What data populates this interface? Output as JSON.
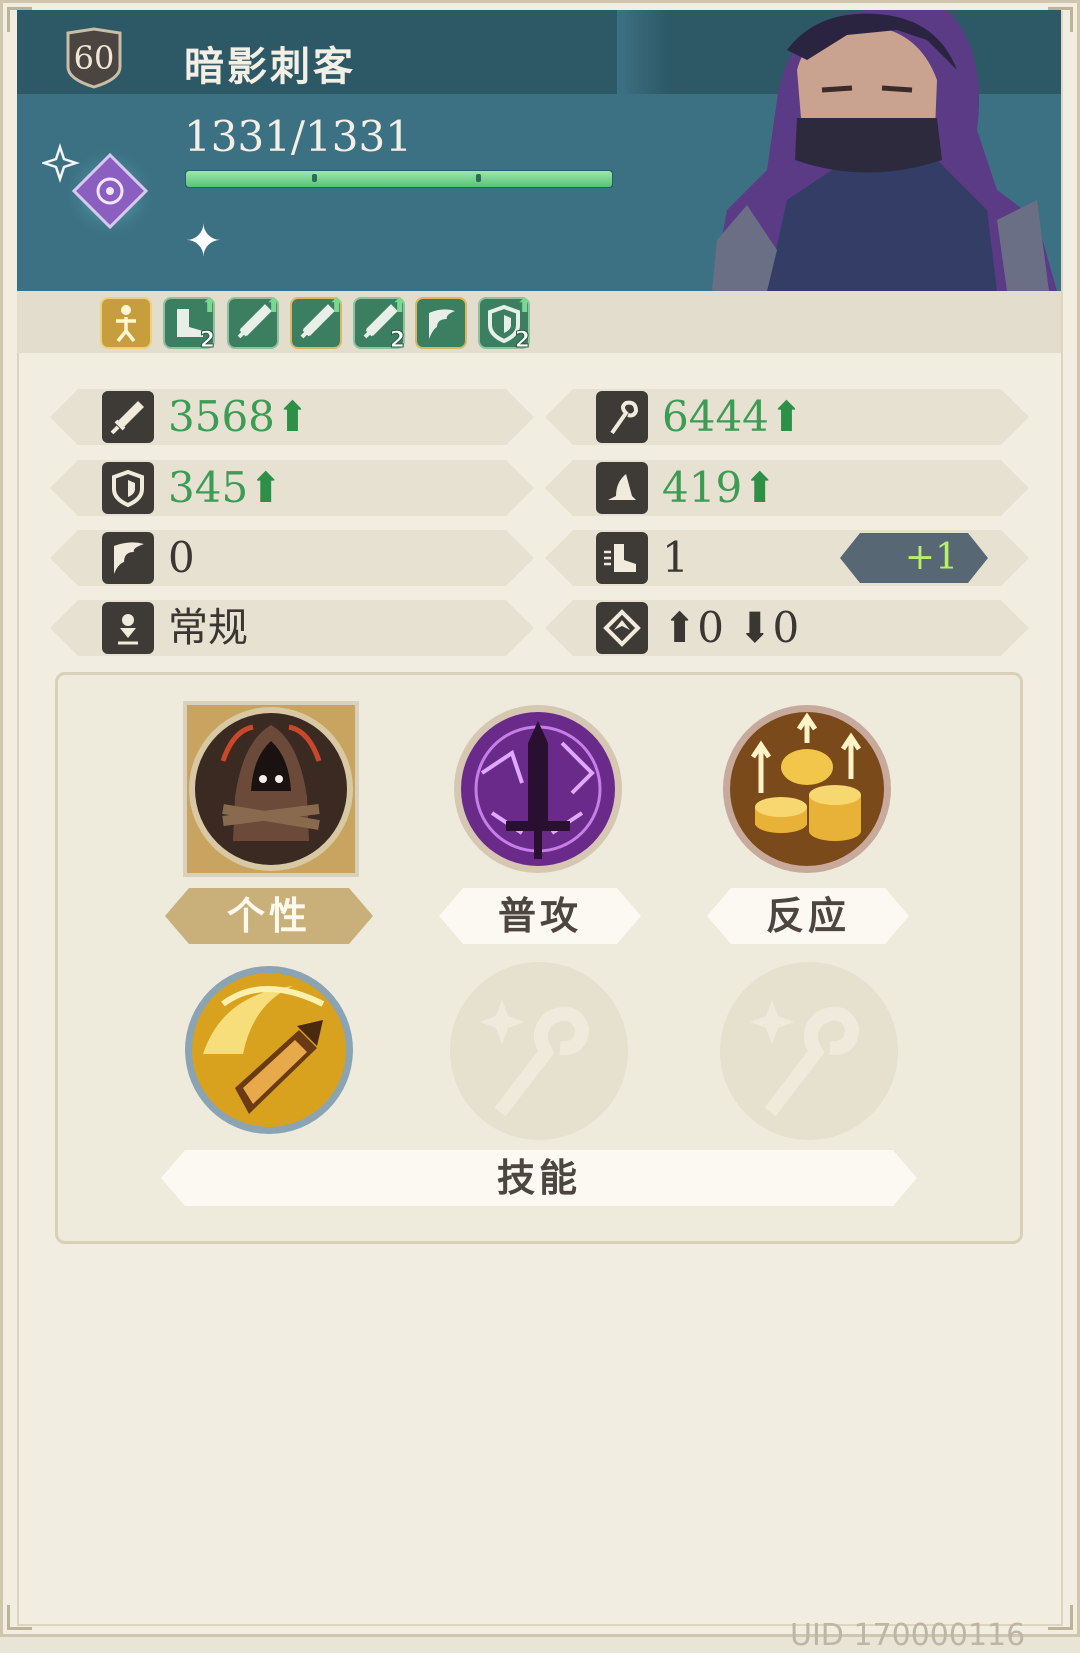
{
  "header": {
    "level": "60",
    "name": "暗影刺客",
    "hp_text": "1331/1331",
    "hp_fraction": 1.0,
    "element_icon": "arcane-eye-diamond-icon",
    "star_icon": "✦"
  },
  "buffs": [
    {
      "icon": "full-body-buff-icon",
      "count": ""
    },
    {
      "icon": "speed-boot-up-icon",
      "count": "2"
    },
    {
      "icon": "attack-sword-up-icon",
      "count": ""
    },
    {
      "icon": "attack-sword-up-icon",
      "count": ""
    },
    {
      "icon": "attack-sword-up-icon",
      "count": "2"
    },
    {
      "icon": "evasion-wing-icon",
      "count": ""
    },
    {
      "icon": "defense-shield-up-icon",
      "count": "2"
    }
  ],
  "stats": {
    "attack": {
      "icon": "sword-icon",
      "value": "3568",
      "arrow": "⬆"
    },
    "magic": {
      "icon": "staff-icon",
      "value": "6444",
      "arrow": "⬆"
    },
    "defense": {
      "icon": "shield-icon",
      "value": "345",
      "arrow": "⬆"
    },
    "resistance": {
      "icon": "wizard-hat-icon",
      "value": "419",
      "arrow": "⬆"
    },
    "evasion": {
      "icon": "wing-icon",
      "value": "0"
    },
    "speed": {
      "icon": "boot-icon",
      "value": "1",
      "bonus": "+1"
    },
    "stance": {
      "icon": "pin-icon",
      "value": "常规"
    },
    "elevation": {
      "icon": "diamond-arrows-icon",
      "up_arrow": "⬆",
      "up_value": "0",
      "down_arrow": "⬇",
      "down_value": "0"
    }
  },
  "skills": {
    "trait_label": "个性",
    "normal_attack_label": "普攻",
    "reaction_label": "反应",
    "skill_label": "技能",
    "trait_icon": "hooded-assassin-icon",
    "normal_attack_icon": "purple-sword-icon",
    "reaction_icon": "gold-coins-icon",
    "skill_icon": "golden-dagger-slash-icon",
    "empty_slot_icon": "empty-staff-slot-icon"
  },
  "footer": {
    "uid_text": "UID 170000116"
  },
  "colors": {
    "header_bg": "#3c7184",
    "title_bar_bg": "#2d5865",
    "stat_green": "#3c9c55",
    "hp_green": "#56c47a",
    "panel_bg": "#f1ede0",
    "active_label": "#c9b07b"
  }
}
